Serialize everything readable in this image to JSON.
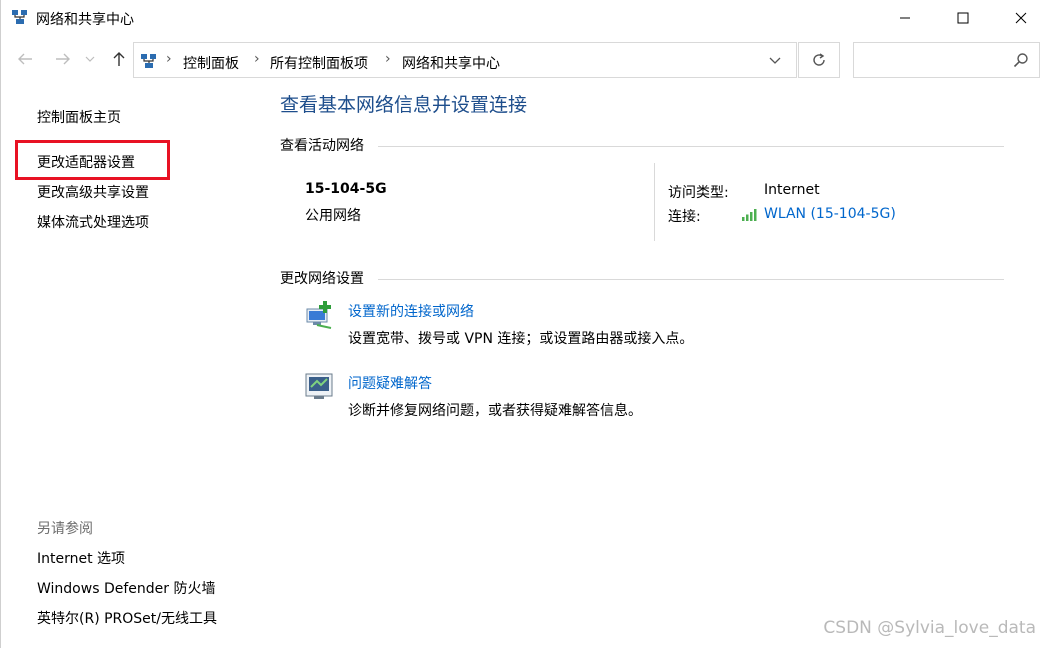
{
  "window": {
    "title": "网络和共享中心"
  },
  "address": {
    "crumbs": [
      "控制面板",
      "所有控制面板项",
      "网络和共享中心"
    ],
    "search_placeholder": ""
  },
  "sidebar": {
    "home": "控制面板主页",
    "links": [
      "更改适配器设置",
      "更改高级共享设置",
      "媒体流式处理选项"
    ],
    "see_also_label": "另请参阅",
    "see_also": [
      "Internet 选项",
      "Windows Defender 防火墙",
      "英特尔(R) PROSet/无线工具"
    ]
  },
  "main": {
    "title": "查看基本网络信息并设置连接",
    "active_section": "查看活动网络",
    "network": {
      "name": "15-104-5G",
      "category": "公用网络",
      "access_label": "访问类型:",
      "access_value": "Internet",
      "conn_label": "连接:",
      "conn_value": "WLAN (15-104-5G)"
    },
    "change_section": "更改网络设置",
    "tasks": [
      {
        "link": "设置新的连接或网络",
        "desc": "设置宽带、拨号或 VPN 连接；或设置路由器或接入点。"
      },
      {
        "link": "问题疑难解答",
        "desc": "诊断并修复网络问题，或者获得疑难解答信息。"
      }
    ]
  },
  "watermark": "CSDN @Sylvia_love_data",
  "colors": {
    "link": "#0066cc",
    "title": "#1e4e8c",
    "highlight": "#e81123"
  }
}
